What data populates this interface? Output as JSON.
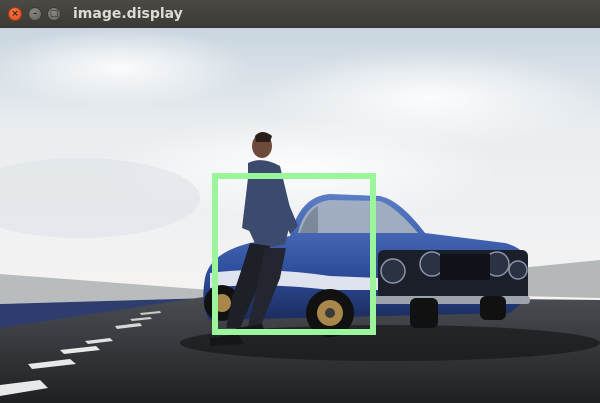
{
  "window": {
    "title": "image.display",
    "close_icon": "close-icon",
    "minimize_icon": "minimize-icon",
    "maximize_icon": "maximize-icon"
  },
  "image": {
    "description_icon": "photo",
    "box_color": "#9bf59a"
  }
}
